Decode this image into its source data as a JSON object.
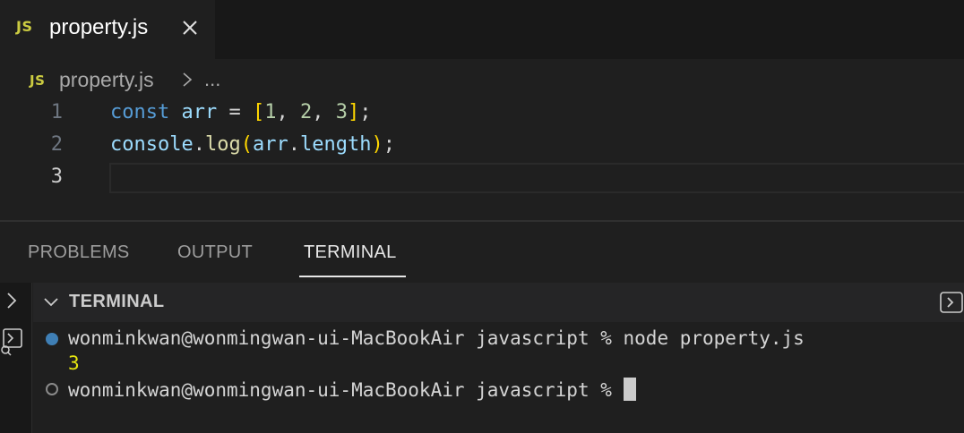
{
  "tab": {
    "badge": "JS",
    "title": "property.js",
    "close_icon": "close-icon"
  },
  "breadcrumb": {
    "badge": "JS",
    "file": "property.js",
    "ellipsis": "..."
  },
  "editor": {
    "lines": [
      {
        "number": "1"
      },
      {
        "number": "2"
      },
      {
        "number": "3"
      }
    ],
    "tokens": {
      "l1": [
        "const",
        "arr",
        "=",
        "[",
        "1",
        ",",
        "2",
        ",",
        "3",
        "]",
        ";"
      ],
      "l2": [
        "console",
        ".",
        "log",
        "(",
        "arr",
        ".",
        "length",
        ")",
        ";"
      ]
    }
  },
  "panel": {
    "tabs": [
      "PROBLEMS",
      "OUTPUT",
      "TERMINAL"
    ],
    "active_tab": "TERMINAL",
    "terminal_title": "TERMINAL"
  },
  "terminal": {
    "prompt1": "wonminkwan@wonmingwan-ui-MacBookAir javascript % node property.js",
    "output": "3",
    "prompt2": "wonminkwan@wonmingwan-ui-MacBookAir javascript % "
  },
  "colors": {
    "js_badge": "#cbcb41",
    "keyword": "#569cd6",
    "variable": "#9cdcfe",
    "number": "#b5cea8",
    "function": "#dcdcaa",
    "bracket_outer": "#ffd700",
    "bracket_inner": "#da70d6",
    "success_dot": "#3f7fb5"
  }
}
